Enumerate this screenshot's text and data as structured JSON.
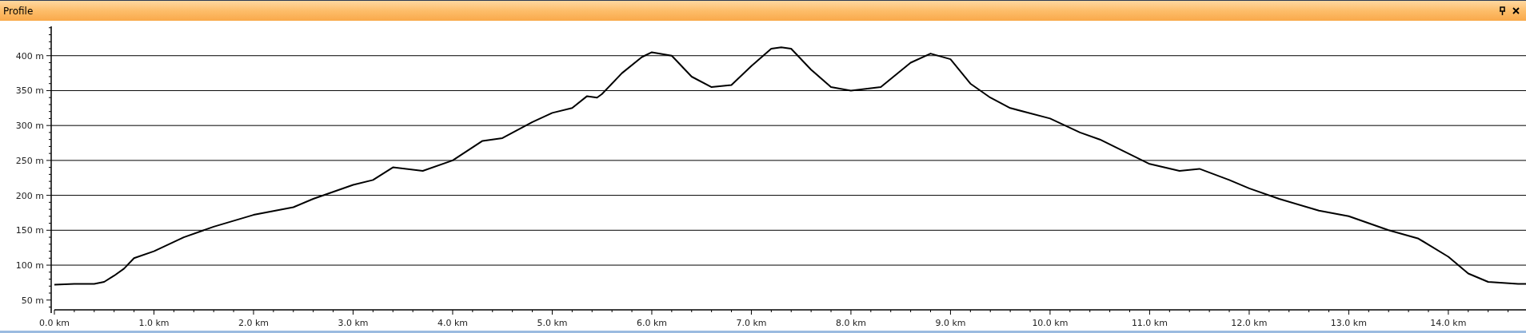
{
  "panel": {
    "title": "Profile"
  },
  "chart_data": {
    "type": "line",
    "grid": true,
    "xlim": [
      0,
      14.78
    ],
    "ylim": [
      36,
      442
    ],
    "x": [
      0,
      0.2,
      0.4,
      0.5,
      0.6,
      0.7,
      0.8,
      1.0,
      1.3,
      1.6,
      2.0,
      2.4,
      2.6,
      3.0,
      3.2,
      3.4,
      3.7,
      4.0,
      4.3,
      4.5,
      4.8,
      5.0,
      5.2,
      5.35,
      5.45,
      5.5,
      5.7,
      5.9,
      6.0,
      6.2,
      6.4,
      6.6,
      6.8,
      7.0,
      7.2,
      7.3,
      7.4,
      7.6,
      7.8,
      8.0,
      8.3,
      8.6,
      8.8,
      9.0,
      9.2,
      9.4,
      9.6,
      10.0,
      10.3,
      10.5,
      11.0,
      11.3,
      11.5,
      11.8,
      12.0,
      12.3,
      12.7,
      13.0,
      13.4,
      13.7,
      14.0,
      14.2,
      14.4,
      14.7,
      14.78
    ],
    "series": [
      {
        "color": "#000000",
        "values": [
          72,
          73,
          73,
          76,
          85,
          95,
          110,
          120,
          140,
          155,
          172,
          183,
          195,
          215,
          222,
          240,
          235,
          250,
          278,
          282,
          305,
          318,
          325,
          342,
          340,
          345,
          375,
          398,
          405,
          400,
          370,
          355,
          358,
          385,
          410,
          412,
          410,
          380,
          355,
          350,
          355,
          390,
          403,
          395,
          360,
          340,
          325,
          310,
          290,
          280,
          245,
          235,
          238,
          222,
          210,
          195,
          178,
          170,
          150,
          138,
          112,
          88,
          76,
          73,
          73
        ]
      }
    ],
    "xticks": [
      {
        "value": 0,
        "label": "0.0 km"
      },
      {
        "value": 1,
        "label": "1.0 km"
      },
      {
        "value": 2,
        "label": "2.0 km"
      },
      {
        "value": 3,
        "label": "3.0 km"
      },
      {
        "value": 4,
        "label": "4.0 km"
      },
      {
        "value": 5,
        "label": "5.0 km"
      },
      {
        "value": 6,
        "label": "6.0 km"
      },
      {
        "value": 7,
        "label": "7.0 km"
      },
      {
        "value": 8,
        "label": "8.0 km"
      },
      {
        "value": 9,
        "label": "9.0 km"
      },
      {
        "value": 10,
        "label": "10.0 km"
      },
      {
        "value": 11,
        "label": "11.0 km"
      },
      {
        "value": 12,
        "label": "12.0 km"
      },
      {
        "value": 13,
        "label": "13.0 km"
      },
      {
        "value": 14,
        "label": "14.0 km"
      }
    ],
    "yticks": [
      {
        "value": 50,
        "label": "50 m"
      },
      {
        "value": 100,
        "label": "100 m"
      },
      {
        "value": 150,
        "label": "150 m"
      },
      {
        "value": 200,
        "label": "200 m"
      },
      {
        "value": 250,
        "label": "250 m"
      },
      {
        "value": 300,
        "label": "300 m"
      },
      {
        "value": 350,
        "label": "350 m"
      },
      {
        "value": 400,
        "label": "400 m"
      }
    ]
  }
}
